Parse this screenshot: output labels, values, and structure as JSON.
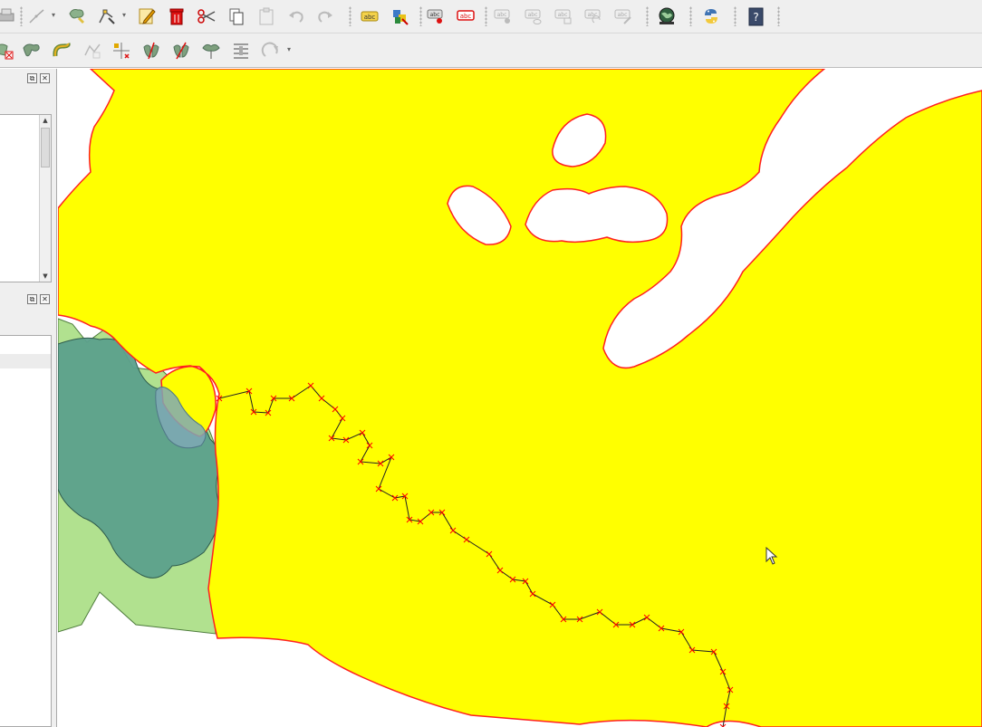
{
  "toolbar_top": {
    "icons": [
      "print-icon",
      "digitize-line-icon",
      "add-feature-icon",
      "vertex-tool-icon",
      "toggle-editing-icon",
      "delete-selected-icon",
      "cut-features-icon",
      "copy-features-icon",
      "paste-features-icon",
      "undo-icon",
      "redo-icon",
      "label-tool-icon",
      "layer-labeling-icon",
      "pin-labels-icon",
      "highlight-labels-icon",
      "show-hide-labels-icon",
      "move-label-icon",
      "rotate-label-icon",
      "change-label-icon",
      "plugin-globe-icon",
      "python-console-icon",
      "help-icon"
    ],
    "label_abc": "abc"
  },
  "toolbar_advanced": {
    "icons": [
      "delete-part-icon",
      "reshape-features-icon",
      "offset-curve-icon",
      "simplify-feature-icon",
      "snapping-icon",
      "split-features-icon",
      "split-parts-icon",
      "merge-features-icon",
      "align-features-icon",
      "rotate-point-symbols-icon"
    ]
  },
  "panels": [
    {
      "name": "layers-panel",
      "float_icon": "float-icon",
      "close_icon": "close-icon"
    },
    {
      "name": "browser-panel",
      "float_icon": "float-icon",
      "close_icon": "close-icon"
    }
  ],
  "colors": {
    "yellow_polygon": "#ffff00",
    "teal_polygon": "#5ca08c",
    "light_green_polygon": "#b1e18f",
    "vertex_marker": "#ff0000",
    "outline_red": "#ff2020",
    "toolbar_bg": "#efefef"
  },
  "map": {
    "cursor_icon": "mouse-pointer-icon"
  }
}
